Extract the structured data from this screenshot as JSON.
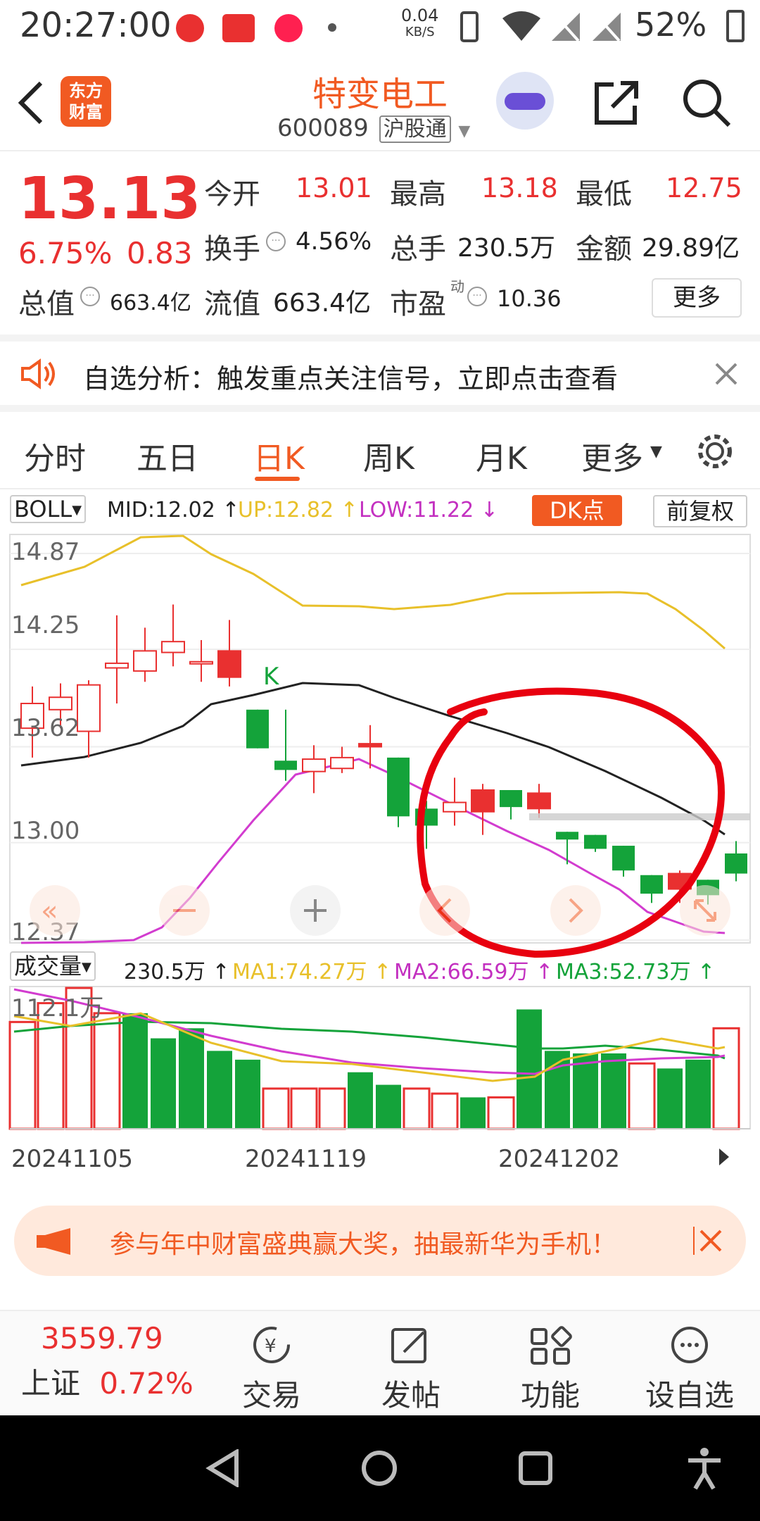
{
  "status_bar": {
    "time": "20:27:00",
    "net_speed_value": "0.04",
    "net_speed_unit": "KB/S",
    "battery": "52%"
  },
  "header": {
    "logo_line1": "东方",
    "logo_line2": "财富",
    "stock_name": "特变电工",
    "stock_code": "600089",
    "market_tag": "沪股通"
  },
  "quote": {
    "price": "13.13",
    "change_pct": "6.75%",
    "change": "0.83",
    "open_label": "今开",
    "open": "13.01",
    "high_label": "最高",
    "high": "13.18",
    "low_label": "最低",
    "low": "12.75",
    "turnover_label": "换手",
    "turnover": "4.56%",
    "volume_label": "总手",
    "volume": "230.5万",
    "amount_label": "金额",
    "amount": "29.89亿",
    "mktcap_label": "总值",
    "mktcap": "663.4亿",
    "float_label": "流值",
    "float_cap": "663.4亿",
    "pe_label": "市盈",
    "pe_sup": "动",
    "pe": "10.36",
    "more_button": "更多"
  },
  "banner": {
    "text": "自选分析：触发重点关注信号，立即点击查看"
  },
  "tabs": [
    "分时",
    "五日",
    "日K",
    "周K",
    "月K",
    "更多"
  ],
  "active_tab": "日K",
  "indicator": {
    "name": "BOLL",
    "mid": "MID:12.02",
    "up": "UP:12.82",
    "low": "LOW:11.22",
    "dk_button": "DK点",
    "adjust_button": "前复权"
  },
  "price_axis": [
    "14.87",
    "14.25",
    "13.62",
    "13.00",
    "12.37"
  ],
  "k_marker": "K",
  "volume_bar": {
    "name": "成交量",
    "current": "230.5万",
    "ma1": "MA1:74.27万",
    "ma2": "MA2:66.59万",
    "ma3": "MA3:52.73万",
    "top_label": "112.1万"
  },
  "dates": [
    "20241105",
    "20241119",
    "20241202"
  ],
  "ad": {
    "text": "参与年中财富盛典赢大奖，抽最新华为手机！"
  },
  "bottom_bar": {
    "index_value": "3559.79",
    "index_name": "上证",
    "index_change": "0.72%",
    "items": [
      "交易",
      "发帖",
      "功能",
      "设自选"
    ]
  },
  "colors": {
    "up": "#e93030",
    "down": "#14a33a",
    "accent": "#f15a22",
    "boll_up": "#e8c02a",
    "boll_low": "#d23ccf"
  },
  "chart_data": {
    "type": "candlestick",
    "y_axis_ticks": [
      14.87,
      14.25,
      13.62,
      13.0,
      12.37
    ],
    "candles": [
      {
        "o": 13.74,
        "c": 13.9,
        "h": 14.01,
        "l": 13.55,
        "up": true
      },
      {
        "o": 13.86,
        "c": 13.94,
        "h": 14.03,
        "l": 13.74,
        "up": true
      },
      {
        "o": 13.72,
        "c": 14.02,
        "h": 14.05,
        "l": 13.55,
        "up": true
      },
      {
        "o": 14.13,
        "c": 14.16,
        "h": 14.47,
        "l": 13.9,
        "up": true
      },
      {
        "o": 14.11,
        "c": 14.24,
        "h": 14.39,
        "l": 14.04,
        "up": true
      },
      {
        "o": 14.23,
        "c": 14.3,
        "h": 14.54,
        "l": 14.14,
        "up": true
      },
      {
        "o": 14.16,
        "c": 14.17,
        "h": 14.31,
        "l": 14.04,
        "up": true
      },
      {
        "o": 14.07,
        "c": 14.24,
        "h": 14.44,
        "l": 14.01,
        "up": true
      },
      {
        "o": 13.86,
        "c": 13.61,
        "h": 13.86,
        "l": 13.61,
        "up": false
      },
      {
        "o": 13.53,
        "c": 13.47,
        "h": 13.86,
        "l": 13.4,
        "up": false
      },
      {
        "o": 13.46,
        "c": 13.54,
        "h": 13.63,
        "l": 13.32,
        "up": true
      },
      {
        "o": 13.48,
        "c": 13.55,
        "h": 13.62,
        "l": 13.45,
        "up": true
      },
      {
        "o": 13.64,
        "c": 13.62,
        "h": 13.76,
        "l": 13.48,
        "up": true
      },
      {
        "o": 13.55,
        "c": 13.17,
        "h": 13.55,
        "l": 13.1,
        "up": false
      },
      {
        "o": 13.22,
        "c": 13.11,
        "h": 13.27,
        "l": 12.96,
        "up": false
      },
      {
        "o": 13.2,
        "c": 13.26,
        "h": 13.42,
        "l": 13.11,
        "up": true
      },
      {
        "o": 13.2,
        "c": 13.34,
        "h": 13.38,
        "l": 13.05,
        "up": true
      },
      {
        "o": 13.34,
        "c": 13.23,
        "h": 13.34,
        "l": 13.15,
        "up": false
      },
      {
        "o": 13.22,
        "c": 13.32,
        "h": 13.38,
        "l": 13.16,
        "up": true
      },
      {
        "o": 13.07,
        "c": 13.02,
        "h": 13.07,
        "l": 12.86,
        "up": false
      },
      {
        "o": 13.05,
        "c": 12.96,
        "h": 13.05,
        "l": 12.94,
        "up": false
      },
      {
        "o": 12.98,
        "c": 12.82,
        "h": 12.98,
        "l": 12.78,
        "up": false
      },
      {
        "o": 12.79,
        "c": 12.67,
        "h": 12.79,
        "l": 12.61,
        "up": false
      },
      {
        "o": 12.7,
        "c": 12.8,
        "h": 12.82,
        "l": 12.61,
        "up": true
      },
      {
        "o": 12.76,
        "c": 12.66,
        "h": 12.76,
        "l": 12.6,
        "up": false
      },
      {
        "o": 12.93,
        "c": 12.8,
        "h": 13.01,
        "l": 12.75,
        "up": false
      }
    ],
    "volume_max": 112.1
  }
}
